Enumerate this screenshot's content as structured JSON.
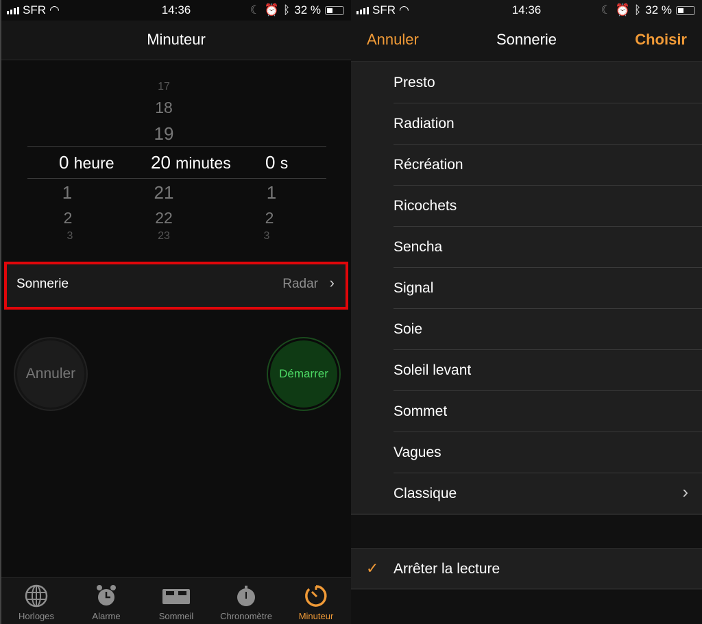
{
  "status": {
    "carrier": "SFR",
    "time": "14:36",
    "battery": "32 %",
    "battery_level": 0.32
  },
  "left": {
    "title": "Minuteur",
    "picker": {
      "hours_above": [],
      "hours_selected": "0",
      "hours_unit": "heure",
      "hours_below": [
        "1",
        "2",
        "3"
      ],
      "minutes_above": [
        "17",
        "18",
        "19"
      ],
      "minutes_selected": "20",
      "minutes_unit": "minutes",
      "minutes_below": [
        "21",
        "22",
        "23"
      ],
      "seconds_selected": "0",
      "seconds_unit": "s",
      "seconds_below": [
        "1",
        "2",
        "3"
      ]
    },
    "sonnerie_label": "Sonnerie",
    "sonnerie_value": "Radar",
    "cancel_label": "Annuler",
    "start_label": "Démarrer",
    "tabs": [
      {
        "label": "Horloges",
        "icon": "globe-icon"
      },
      {
        "label": "Alarme",
        "icon": "alarm-clock-icon"
      },
      {
        "label": "Sommeil",
        "icon": "bed-icon"
      },
      {
        "label": "Chronomètre",
        "icon": "stopwatch-icon"
      },
      {
        "label": "Minuteur",
        "icon": "timer-icon",
        "active": true
      }
    ]
  },
  "right": {
    "cancel_label": "Annuler",
    "title": "Sonnerie",
    "choose_label": "Choisir",
    "tones": [
      "Presto",
      "Radiation",
      "Récréation",
      "Ricochets",
      "Sencha",
      "Signal",
      "Soie",
      "Soleil levant",
      "Sommet",
      "Vagues",
      "Classique"
    ],
    "stop_label": "Arrêter la lecture"
  },
  "colors": {
    "accent": "#f09a37",
    "highlight_box": "#e0060a",
    "start_green": "#4cd964"
  }
}
